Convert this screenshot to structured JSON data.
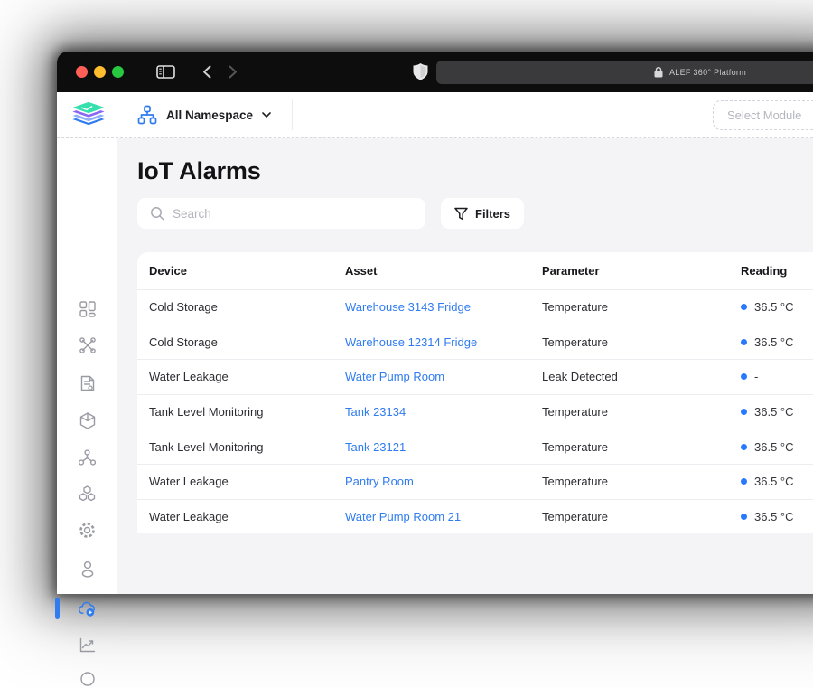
{
  "browser": {
    "url_label": "ALEF 360° Platform",
    "traffic_lights": {
      "close": "#FF5F57",
      "minimize": "#FEBC2E",
      "maximize": "#28C840"
    }
  },
  "header": {
    "namespace_label": "All Namespace",
    "module_select_placeholder": "Select Module"
  },
  "sidebar": {
    "items": [
      {
        "icon": "dashboard-grid-icon",
        "active": false
      },
      {
        "icon": "tools-icon",
        "active": false
      },
      {
        "icon": "report-document-icon",
        "active": false
      },
      {
        "icon": "cube-icon",
        "active": false
      },
      {
        "icon": "network-nodes-icon",
        "active": false
      },
      {
        "icon": "cubes-stack-icon",
        "active": false
      },
      {
        "icon": "gear-icon",
        "active": false
      },
      {
        "icon": "user-icon",
        "active": false
      },
      {
        "icon": "cloud-sync-icon",
        "active": true
      },
      {
        "icon": "chart-icon",
        "active": false
      },
      {
        "icon": "bottom-partial-icon",
        "active": false
      }
    ]
  },
  "page": {
    "title": "IoT Alarms",
    "search_placeholder": "Search",
    "filters_label": "Filters"
  },
  "table": {
    "columns": [
      "Device",
      "Asset",
      "Parameter",
      "Reading"
    ],
    "rows": [
      {
        "device": "Cold Storage",
        "asset": "Warehouse 3143  Fridge",
        "parameter": "Temperature",
        "reading": "36.5 °C"
      },
      {
        "device": "Cold Storage",
        "asset": "Warehouse 12314  Fridge",
        "parameter": "Temperature",
        "reading": "36.5 °C"
      },
      {
        "device": "Water Leakage",
        "asset": "Water Pump Room",
        "parameter": "Leak Detected",
        "reading": "-"
      },
      {
        "device": "Tank Level Monitoring",
        "asset": "Tank 23134",
        "parameter": "Temperature",
        "reading": "36.5 °C"
      },
      {
        "device": "Tank Level Monitoring",
        "asset": "Tank 23121",
        "parameter": "Temperature",
        "reading": "36.5 °C"
      },
      {
        "device": "Water Leakage",
        "asset": "Pantry Room",
        "parameter": "Temperature",
        "reading": "36.5 °C"
      },
      {
        "device": "Water Leakage",
        "asset": "Water Pump Room 21",
        "parameter": "Temperature",
        "reading": "36.5 °C"
      }
    ]
  },
  "colors": {
    "accent_blue": "#2F7BF0",
    "reading_dot": "#2979FF",
    "content_bg": "#F4F4F6",
    "titlebar_bg": "#0D0D0D",
    "urlbar_bg": "#3A3A3C"
  }
}
